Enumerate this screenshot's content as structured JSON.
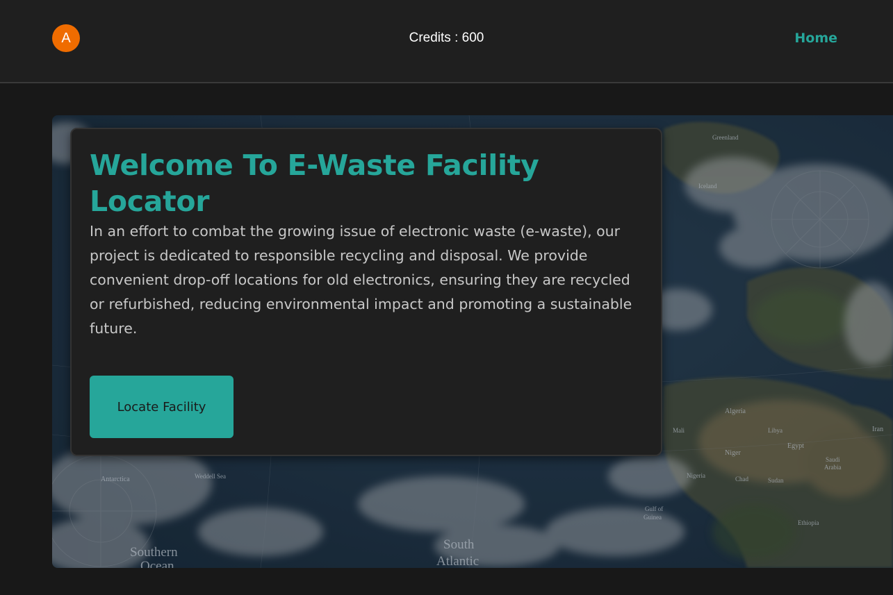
{
  "navbar": {
    "avatar_initial": "A",
    "credits": "Credits : 600",
    "home_label": "Home"
  },
  "hero": {
    "map_labels": {
      "greenland": "Greenland",
      "iceland": "Iceland",
      "antarctica": "Antarctica",
      "weddell_sea": "Weddell Sea",
      "southern_ocean_line1": "Southern",
      "southern_ocean_line2": "Ocean",
      "south_atlantic_line1": "South",
      "south_atlantic_line2": "Atlantic",
      "algeria": "Algeria",
      "mali": "Mali",
      "niger": "Niger",
      "libya": "Libya",
      "egypt": "Egypt",
      "iran": "Iran",
      "saudi_arabia_line1": "Saudi",
      "saudi_arabia_line2": "Arabia",
      "nigeria": "Nigeria",
      "chad": "Chad",
      "sudan": "Sudan",
      "gulf_of_guinea_line1": "Gulf of",
      "gulf_of_guinea_line2": "Guinea",
      "ethiopia": "Ethiopia"
    }
  },
  "card": {
    "title": "Welcome To E-Waste Facility Locator",
    "description": "In an effort to combat the growing issue of electronic waste (e-waste), our project is dedicated to responsible recycling and disposal. We provide convenient drop-off locations for old electronics, ensuring they are recycled or refurbished, reducing environmental impact and promoting a sustainable future.",
    "button_label": "Locate Facility"
  },
  "colors": {
    "accent": "#26a69a",
    "avatar": "#ef6c00",
    "navbar_bg": "#1f1f1f",
    "page_bg": "#181818",
    "card_bg": "#1f1f1f"
  }
}
